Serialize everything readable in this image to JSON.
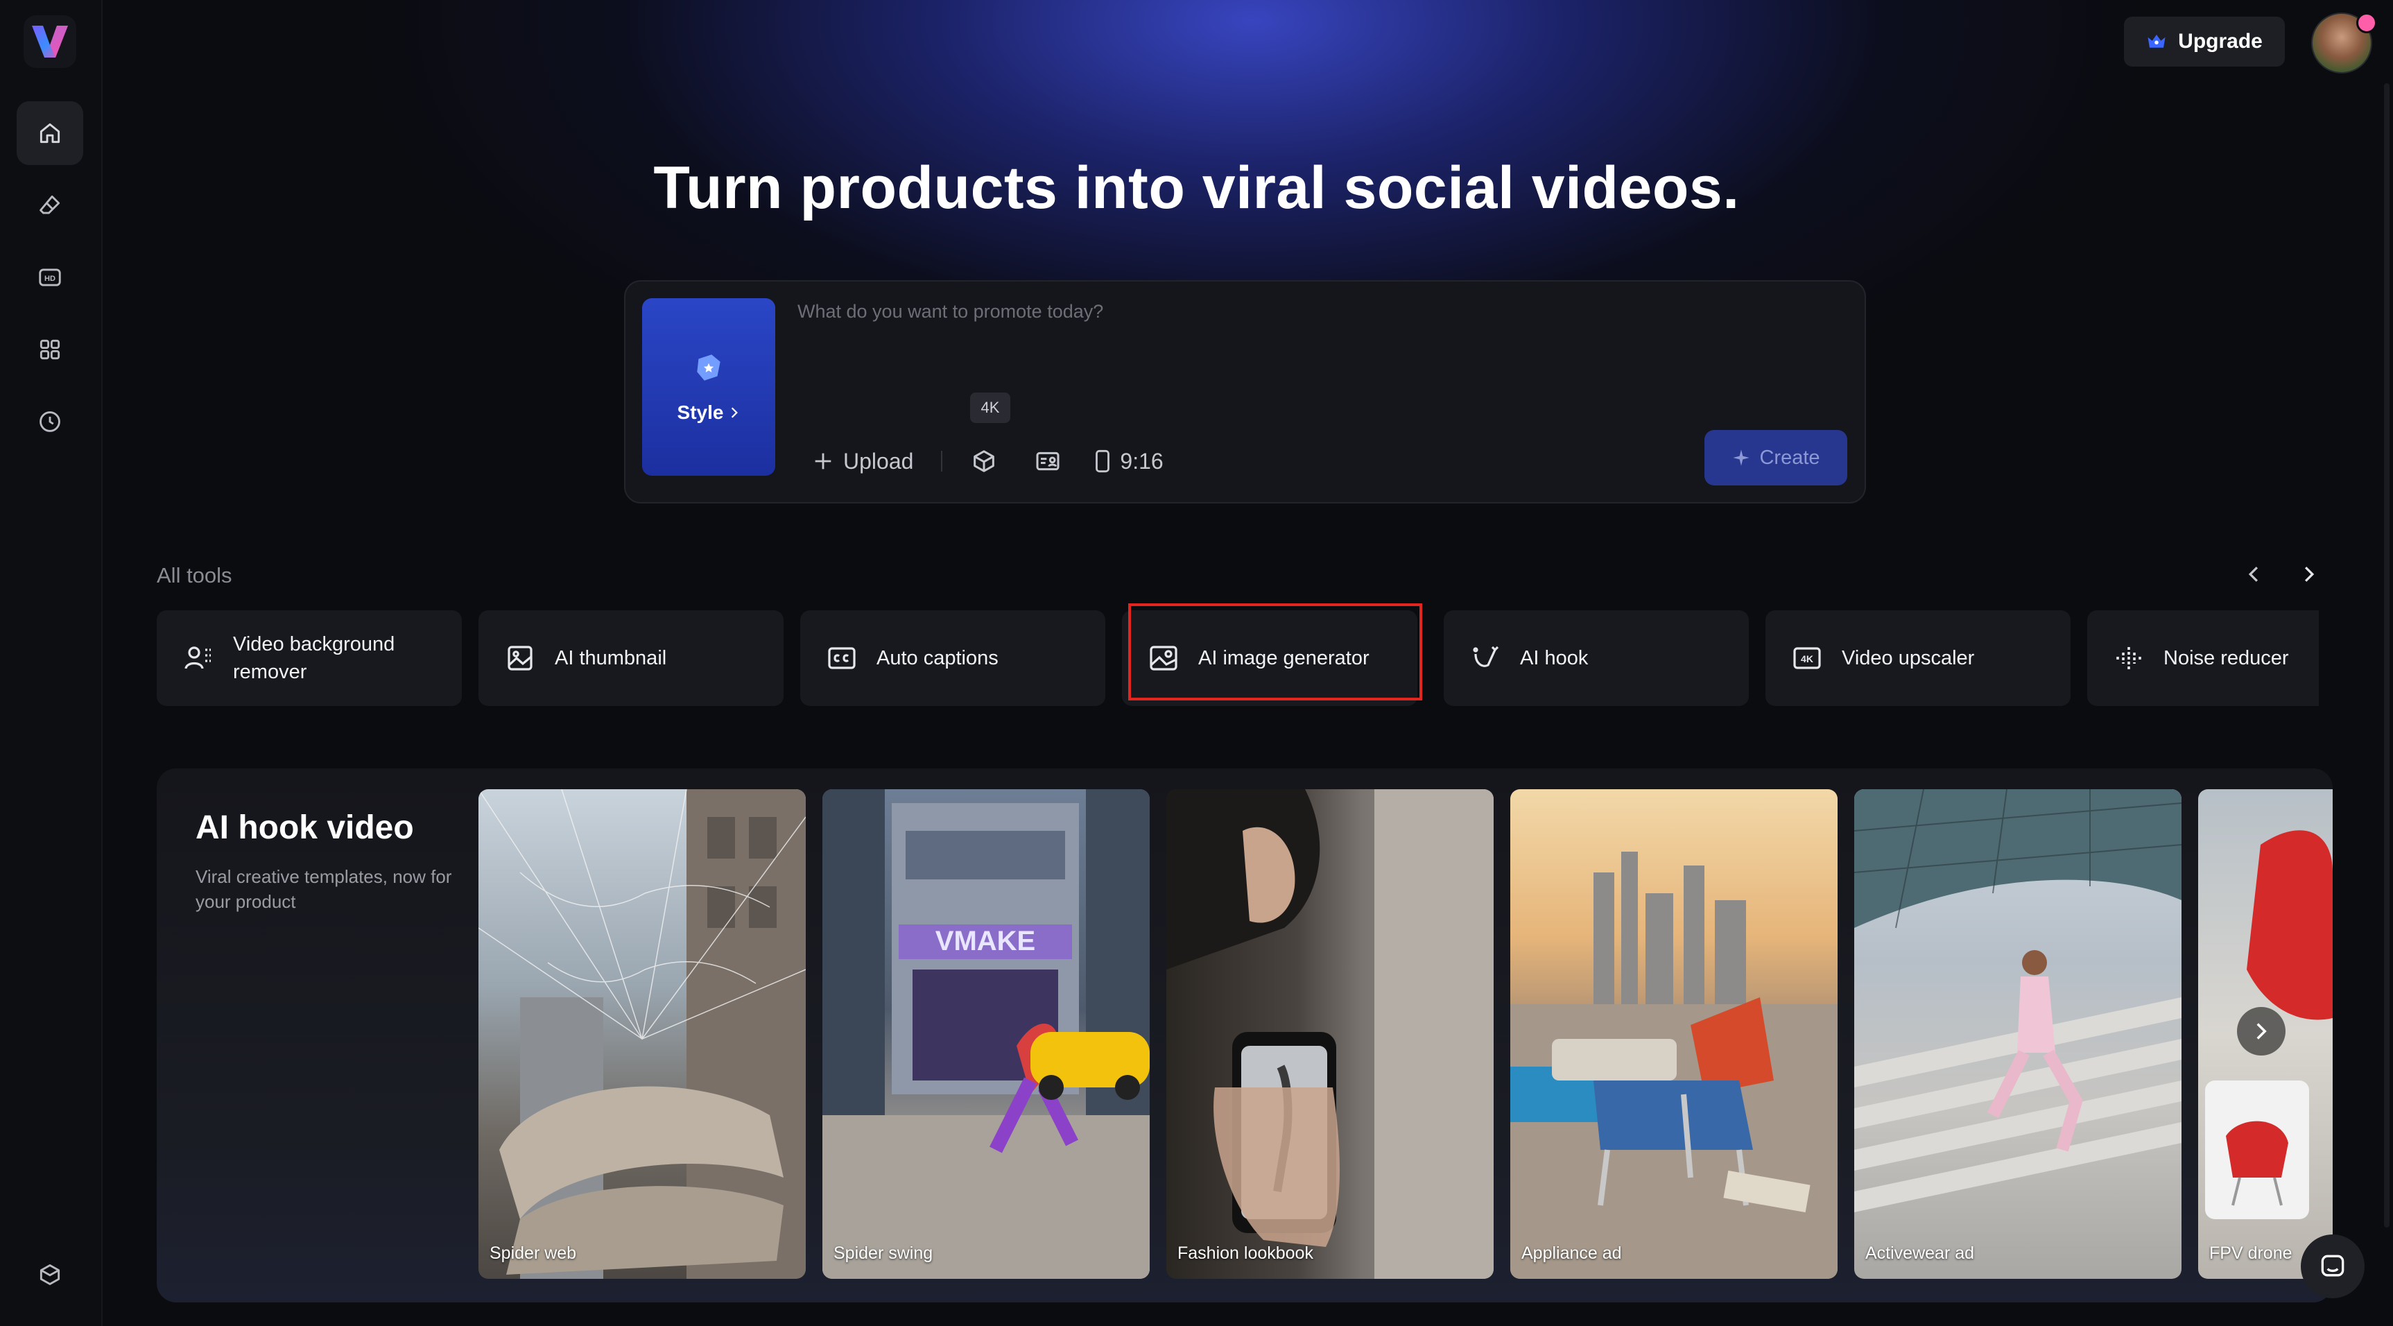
{
  "app": {
    "logo_letter": "V"
  },
  "sidebar": {
    "items": [
      {
        "name": "home",
        "icon": "home-icon",
        "active": true
      },
      {
        "name": "eraser",
        "icon": "eraser-icon"
      },
      {
        "name": "hd",
        "icon": "hd-icon",
        "icon_text": "HD"
      },
      {
        "name": "apps",
        "icon": "grid-icon"
      },
      {
        "name": "history",
        "icon": "clock-icon"
      }
    ],
    "bottom_icon": "box-icon"
  },
  "header": {
    "upgrade_label": "Upgrade"
  },
  "hero": {
    "title": "Turn products into viral social videos.",
    "prompt": {
      "style_label": "Style",
      "placeholder": "What do you want to promote today?",
      "upload_label": "Upload",
      "badge": "4K",
      "ratio": "9:16",
      "create_label": "Create"
    }
  },
  "tools": {
    "section_label": "All tools",
    "items": [
      {
        "label": "Video background remover",
        "icon": "person-remove-icon"
      },
      {
        "label": "AI thumbnail",
        "icon": "thumbnail-icon"
      },
      {
        "label": "Auto captions",
        "icon": "captions-icon"
      },
      {
        "label": "AI image generator",
        "icon": "image-icon"
      },
      {
        "label": "AI hook",
        "icon": "hook-icon"
      },
      {
        "label": "Video upscaler",
        "icon": "4k-icon",
        "icon_text": "4K"
      },
      {
        "label": "Noise reducer",
        "icon": "noise-icon"
      }
    ]
  },
  "hook_section": {
    "title": "AI hook video",
    "subtitle": "Viral creative templates, now for your product",
    "items": [
      {
        "caption": "Spider web"
      },
      {
        "caption": "Spider swing",
        "sign_text": "VMAKE"
      },
      {
        "caption": "Fashion lookbook"
      },
      {
        "caption": "Appliance ad"
      },
      {
        "caption": "Activewear ad"
      },
      {
        "caption": "FPV drone"
      }
    ]
  },
  "colors": {
    "accent": "#2a46c6",
    "create_bg": "#27378f",
    "highlight": "#e0261f"
  }
}
